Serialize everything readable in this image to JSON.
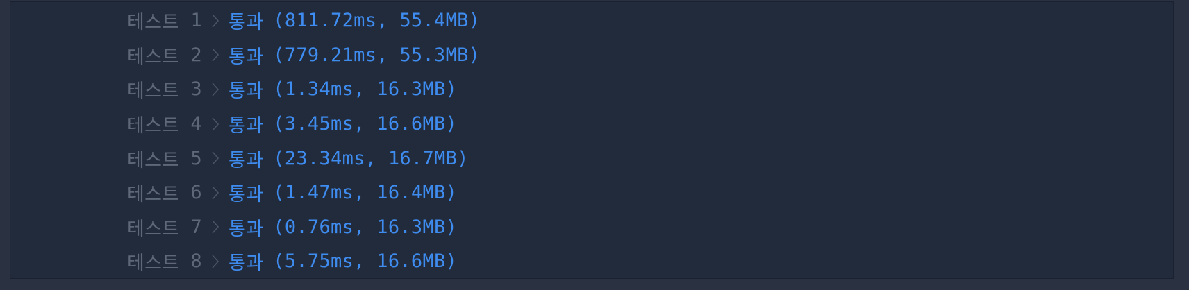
{
  "results": [
    {
      "label": "테스트",
      "number": "1",
      "status": "통과",
      "metrics": "(811.72ms, 55.4MB)"
    },
    {
      "label": "테스트",
      "number": "2",
      "status": "통과",
      "metrics": "(779.21ms, 55.3MB)"
    },
    {
      "label": "테스트",
      "number": "3",
      "status": "통과",
      "metrics": "(1.34ms, 16.3MB)"
    },
    {
      "label": "테스트",
      "number": "4",
      "status": "통과",
      "metrics": "(3.45ms, 16.6MB)"
    },
    {
      "label": "테스트",
      "number": "5",
      "status": "통과",
      "metrics": "(23.34ms, 16.7MB)"
    },
    {
      "label": "테스트",
      "number": "6",
      "status": "통과",
      "metrics": "(1.47ms, 16.4MB)"
    },
    {
      "label": "테스트",
      "number": "7",
      "status": "통과",
      "metrics": "(0.76ms, 16.3MB)"
    },
    {
      "label": "테스트",
      "number": "8",
      "status": "통과",
      "metrics": "(5.75ms, 16.6MB)"
    }
  ],
  "colors": {
    "background": "#2a3241",
    "panel": "#222b3b",
    "label": "#5e6878",
    "pass": "#3f8cf0"
  },
  "icons": {
    "separator": "chevron-right-icon"
  }
}
